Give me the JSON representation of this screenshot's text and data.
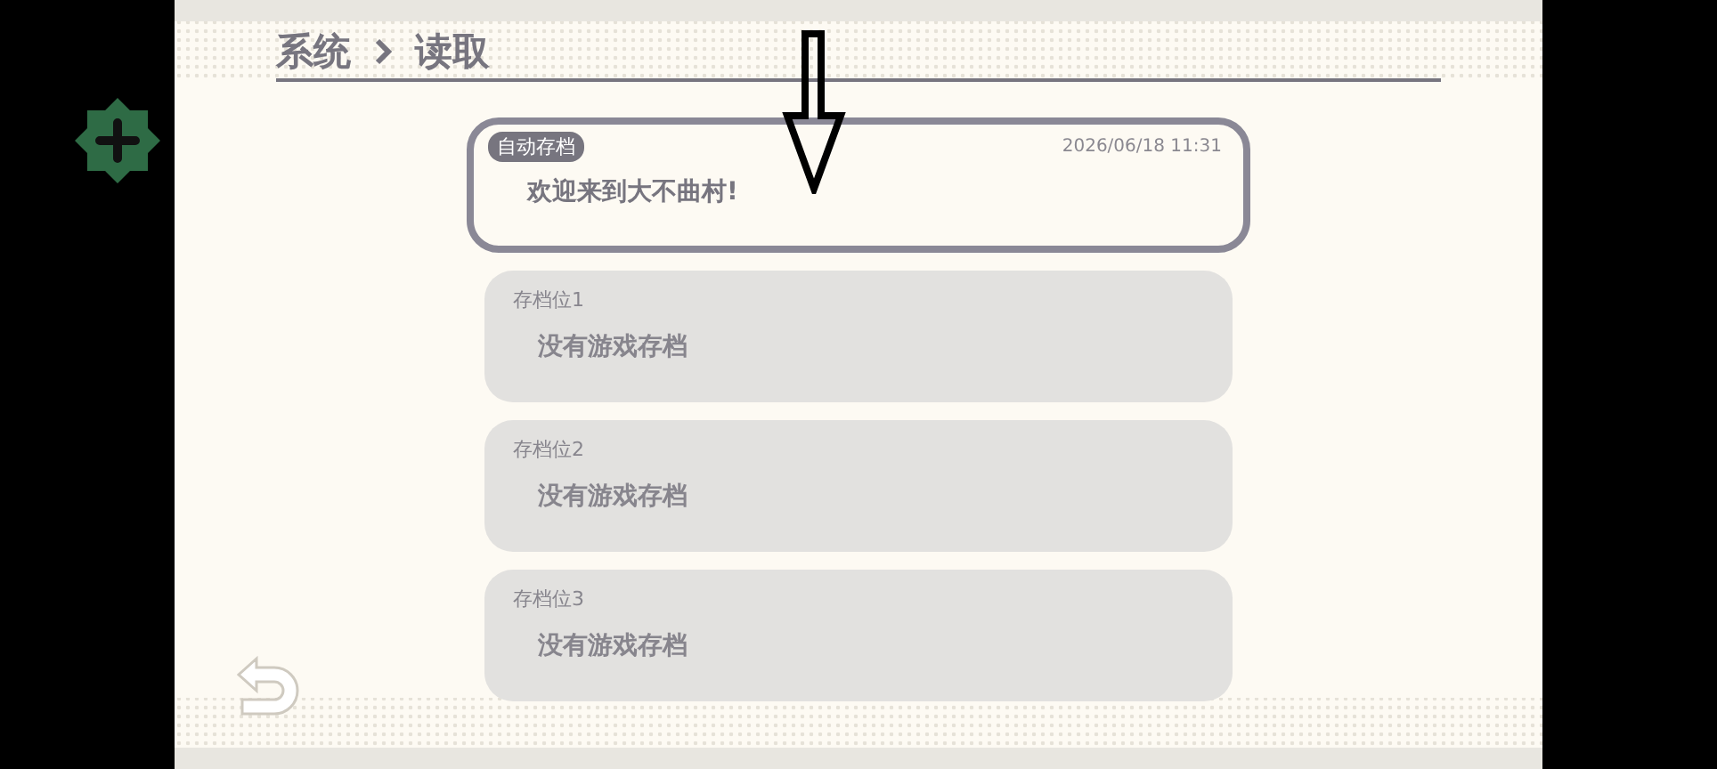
{
  "breadcrumb": [
    {
      "label": "系统"
    },
    {
      "label": "读取"
    }
  ],
  "saves": [
    {
      "kind": "auto",
      "tag": "自动存档",
      "time": "2026/06/18 11:31",
      "text": "欢迎来到大不曲村!",
      "selected": true
    },
    {
      "kind": "slot",
      "label": "存档位1",
      "text": "没有游戏存档",
      "selected": false
    },
    {
      "kind": "slot",
      "label": "存档位2",
      "text": "没有游戏存档",
      "selected": false
    },
    {
      "kind": "slot",
      "label": "存档位3",
      "text": "没有游戏存档",
      "selected": false
    }
  ]
}
